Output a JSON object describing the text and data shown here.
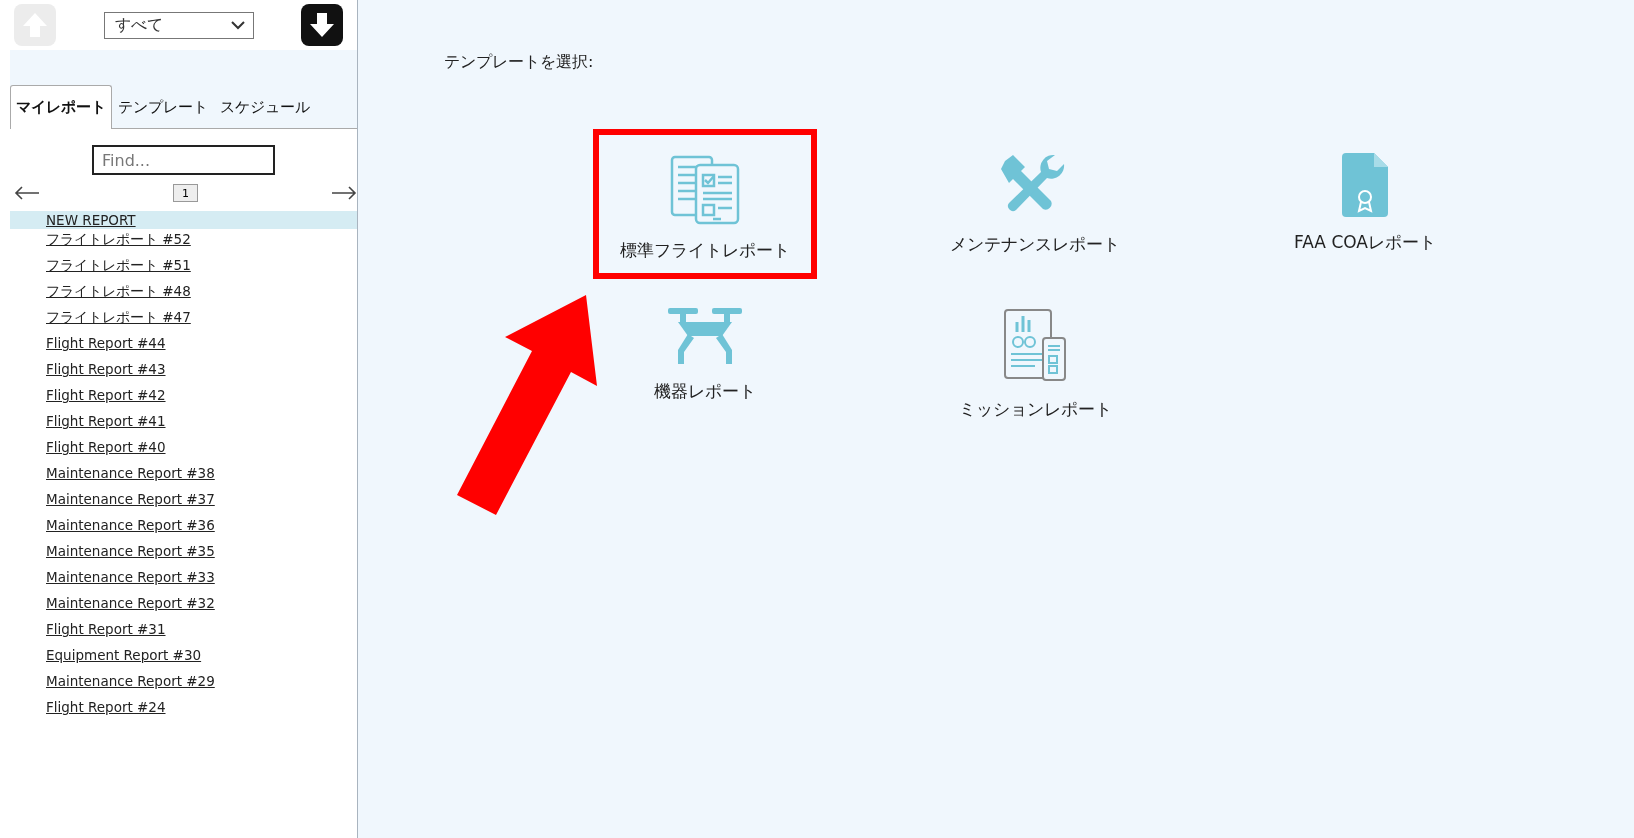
{
  "toolbar": {
    "up_disabled": true,
    "filter": "すべて",
    "down_disabled": false
  },
  "tabs": [
    {
      "label": "マイレポート",
      "selected": true
    },
    {
      "label": "テンプレート",
      "selected": false
    },
    {
      "label": "スケジュール",
      "selected": false
    }
  ],
  "search": {
    "placeholder": "Find..."
  },
  "pager": {
    "page": "1"
  },
  "reports": [
    {
      "label": "NEW REPORT",
      "selected": true
    },
    {
      "label": "フライトレポート #52",
      "selected": false
    },
    {
      "label": "フライトレポート #51",
      "selected": false
    },
    {
      "label": "フライトレポート #48",
      "selected": false
    },
    {
      "label": "フライトレポート #47",
      "selected": false
    },
    {
      "label": "Flight Report #44",
      "selected": false
    },
    {
      "label": "Flight Report #43",
      "selected": false
    },
    {
      "label": "Flight Report #42",
      "selected": false
    },
    {
      "label": "Flight Report #41",
      "selected": false
    },
    {
      "label": "Flight Report #40",
      "selected": false
    },
    {
      "label": "Maintenance Report #38",
      "selected": false
    },
    {
      "label": "Maintenance Report #37",
      "selected": false
    },
    {
      "label": "Maintenance Report #36",
      "selected": false
    },
    {
      "label": "Maintenance Report #35",
      "selected": false
    },
    {
      "label": "Maintenance Report #33",
      "selected": false
    },
    {
      "label": "Maintenance Report #32",
      "selected": false
    },
    {
      "label": "Flight Report #31",
      "selected": false
    },
    {
      "label": "Equipment Report #30",
      "selected": false
    },
    {
      "label": "Maintenance Report #29",
      "selected": false
    },
    {
      "label": "Flight Report #24",
      "selected": false
    }
  ],
  "heading": "テンプレートを選択:",
  "templates": [
    {
      "kind": "flight",
      "label": "標準フライトレポート",
      "highlighted": true
    },
    {
      "kind": "maintenance",
      "label": "メンテナンスレポート",
      "highlighted": false
    },
    {
      "kind": "certificate",
      "label": "FAA COAレポート",
      "highlighted": false
    },
    {
      "kind": "equipment",
      "label": "機器レポート",
      "highlighted": false
    },
    {
      "kind": "mission",
      "label": "ミッションレポート",
      "highlighted": false
    }
  ],
  "callout_arrow": true
}
